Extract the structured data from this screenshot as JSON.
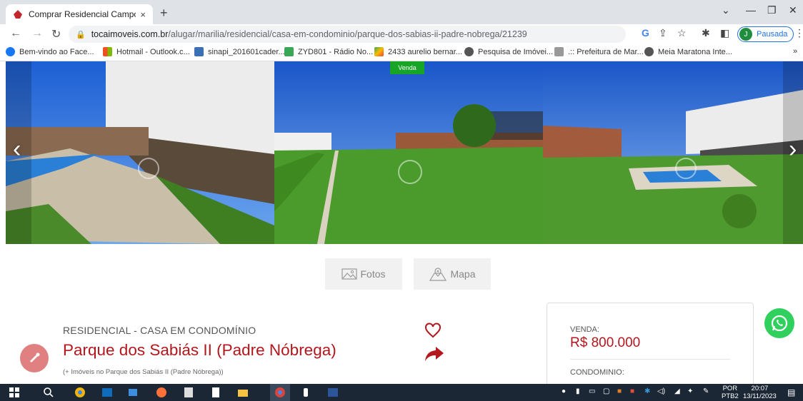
{
  "browser": {
    "tab_title": "Comprar Residencial Campo Bel",
    "tab_close": "×",
    "new_tab": "+",
    "url_host": "tocaimoveis.com.br",
    "url_path": "/alugar/marilia/residencial/casa-em-condominio/parque-dos-sabias-ii-padre-nobrega/21239",
    "profile_initial": "J",
    "profile_label": "Pausada",
    "bookmarks": [
      {
        "label": "Bem-vindo ao Face...",
        "color": "#1877f2"
      },
      {
        "label": "Hotmail - Outlook.c...",
        "color": "#f25022"
      },
      {
        "label": "sinapi_201601cader...",
        "color": "#3b6fb6"
      },
      {
        "label": "ZYD801 - Rádio No...",
        "color": "#3aa757"
      },
      {
        "label": "2433 aurelio bernar...",
        "color": "#34a853"
      },
      {
        "label": "Pesquisa de Imóvei...",
        "color": "#555555"
      },
      {
        "label": ".:: Prefeitura de Mar...",
        "color": "#888888"
      },
      {
        "label": "Meia Maratona Inte...",
        "color": "#555555"
      }
    ],
    "bookmarks_more": "»"
  },
  "gallery": {
    "badge": "Venda",
    "prev_arrow": "‹",
    "next_arrow": "›"
  },
  "media_tabs": {
    "photos": "Fotos",
    "map": "Mapa"
  },
  "property": {
    "type": "RESIDENCIAL - CASA EM CONDOMÍNIO",
    "title": "Parque dos Sabiás II (Padre Nóbrega)",
    "subtitle": "(+ Imóveis no Parque dos Sabiás II (Padre Nóbrega))"
  },
  "pricing": {
    "sale_label": "VENDA:",
    "sale_value": "R$ 800.000",
    "condo_label": "CONDOMINIO:"
  },
  "taskbar": {
    "language": "POR",
    "language_sub": "PTB2",
    "time": "20:07",
    "date": "13/11/2023"
  },
  "colors": {
    "brand_red": "#b3171d",
    "badge_green": "#17a528",
    "whatsapp_green": "#2fd05d"
  }
}
